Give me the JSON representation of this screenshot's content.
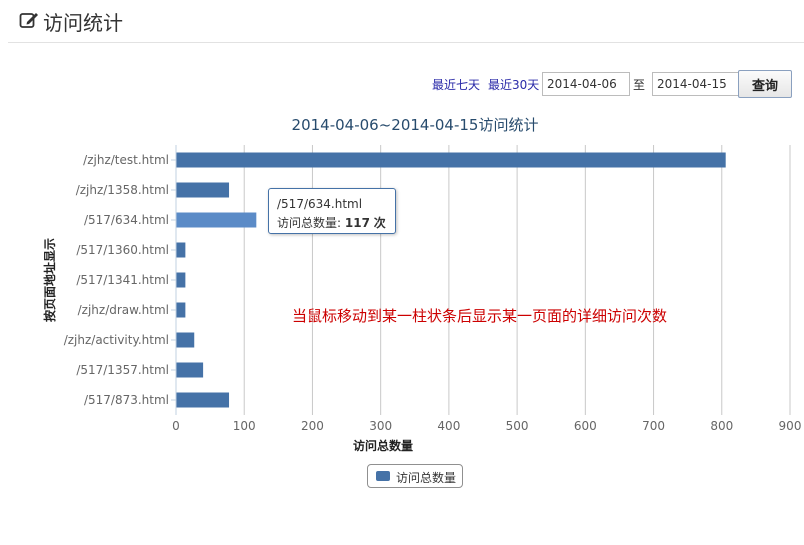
{
  "header": {
    "title": "访问统计",
    "icon": "edit-icon"
  },
  "toolbar": {
    "recent7_label": "最近七天",
    "recent30_label": "最近30天",
    "start_date": "2014-04-06",
    "to_label": "至",
    "end_date": "2014-04-15",
    "query_label": "查询"
  },
  "tooltip": {
    "page": "/517/634.html",
    "label": "访问总数量:",
    "value": "117",
    "unit": "次"
  },
  "annotation": "当鼠标移动到某一柱状条后显示某一页面的详细访问次数",
  "colors": {
    "bar": "#4572a7",
    "bar_hover": "#5b8bc7",
    "link": "#2a2aa8",
    "annotation": "#cc0000"
  },
  "chart_data": {
    "type": "bar",
    "orientation": "horizontal",
    "title": "2014-04-06~2014-04-15访问统计",
    "xlabel": "访问总数量",
    "ylabel": "按页面地址显示",
    "categories": [
      "/zjhz/test.html",
      "/zjhz/1358.html",
      "/517/634.html",
      "/517/1360.html",
      "/517/1341.html",
      "/zjhz/draw.html",
      "/zjhz/activity.html",
      "/517/1357.html",
      "/517/873.html"
    ],
    "series": [
      {
        "name": "访问总数量",
        "values": [
          805,
          77,
          117,
          13,
          13,
          13,
          26,
          39,
          77
        ]
      }
    ],
    "xlim": [
      0,
      900
    ],
    "xticks": [
      0,
      100,
      200,
      300,
      400,
      500,
      600,
      700,
      800,
      900
    ],
    "grid": true,
    "legend": "bottom-center",
    "highlighted_category": "/517/634.html"
  }
}
